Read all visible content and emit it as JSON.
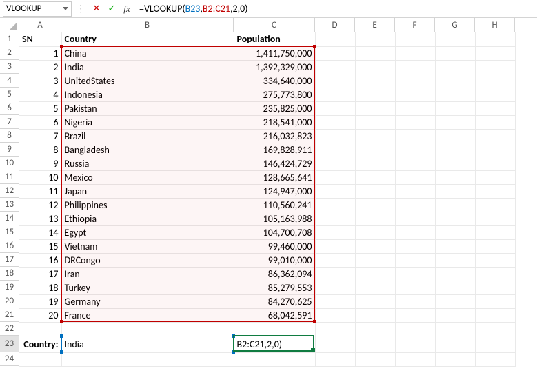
{
  "name_box": "VLOOKUP",
  "formula": {
    "prefix": "=VLOOKUP(",
    "ref1": "B23",
    "sep1": ",",
    "ref2": "B2:C21",
    "sep2": ",",
    "args_tail": "2,0)"
  },
  "columns": [
    "A",
    "B",
    "C",
    "D",
    "E",
    "F",
    "G",
    "H"
  ],
  "headers": {
    "sn": "SN",
    "country": "Country",
    "pop": "Population"
  },
  "rows": [
    {
      "sn": "1",
      "country": "China",
      "pop": "1,411,750,000"
    },
    {
      "sn": "2",
      "country": "India",
      "pop": "1,392,329,000"
    },
    {
      "sn": "3",
      "country": "UnitedStates",
      "pop": "334,640,000"
    },
    {
      "sn": "4",
      "country": "Indonesia",
      "pop": "275,773,800"
    },
    {
      "sn": "5",
      "country": "Pakistan",
      "pop": "235,825,000"
    },
    {
      "sn": "6",
      "country": "Nigeria",
      "pop": "218,541,000"
    },
    {
      "sn": "7",
      "country": "Brazil",
      "pop": "216,032,823"
    },
    {
      "sn": "8",
      "country": "Bangladesh",
      "pop": "169,828,911"
    },
    {
      "sn": "9",
      "country": "Russia",
      "pop": "146,424,729"
    },
    {
      "sn": "10",
      "country": "Mexico",
      "pop": "128,665,641"
    },
    {
      "sn": "11",
      "country": "Japan",
      "pop": "124,947,000"
    },
    {
      "sn": "12",
      "country": "Philippines",
      "pop": "110,560,241"
    },
    {
      "sn": "13",
      "country": "Ethiopia",
      "pop": "105,163,988"
    },
    {
      "sn": "14",
      "country": "Egypt",
      "pop": "104,700,708"
    },
    {
      "sn": "15",
      "country": "Vietnam",
      "pop": "99,460,000"
    },
    {
      "sn": "16",
      "country": "DRCongo",
      "pop": "99,010,000"
    },
    {
      "sn": "17",
      "country": "Iran",
      "pop": "86,362,094"
    },
    {
      "sn": "18",
      "country": "Turkey",
      "pop": "85,279,553"
    },
    {
      "sn": "19",
      "country": "Germany",
      "pop": "84,270,625"
    },
    {
      "sn": "20",
      "country": "France",
      "pop": "68,042,591"
    }
  ],
  "lookup": {
    "label": "Country:",
    "value": "India",
    "result_cell_text": "B2:C21,2,0)"
  },
  "row_count": 24,
  "extra_cols": 5
}
